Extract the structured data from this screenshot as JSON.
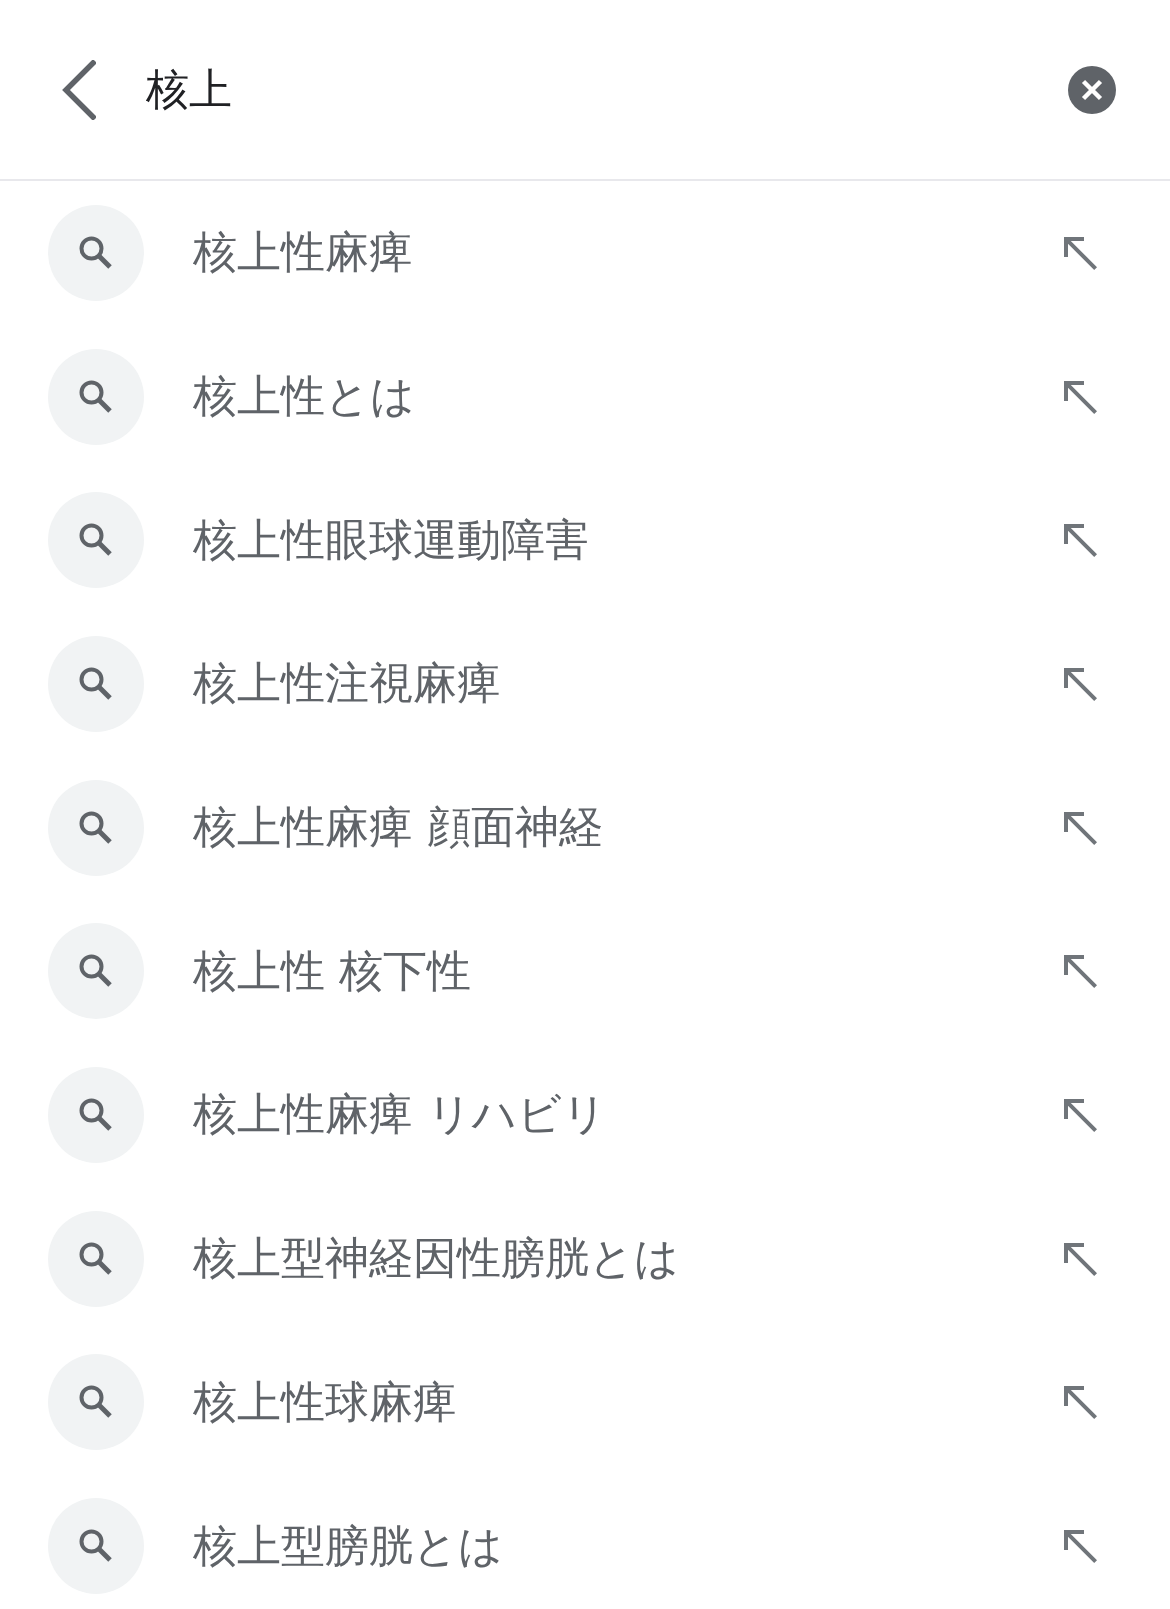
{
  "search_bar": {
    "query": "核上"
  },
  "suggestions": [
    {
      "text": "核上性麻痺"
    },
    {
      "text": "核上性とは"
    },
    {
      "text": "核上性眼球運動障害"
    },
    {
      "text": "核上性注視麻痺"
    },
    {
      "text": "核上性麻痺 顔面神経"
    },
    {
      "text": "核上性 核下性"
    },
    {
      "text": "核上性麻痺 リハビリ"
    },
    {
      "text": "核上型神経因性膀胱とは"
    },
    {
      "text": "核上性球麻痺"
    },
    {
      "text": "核上型膀胱とは"
    }
  ]
}
